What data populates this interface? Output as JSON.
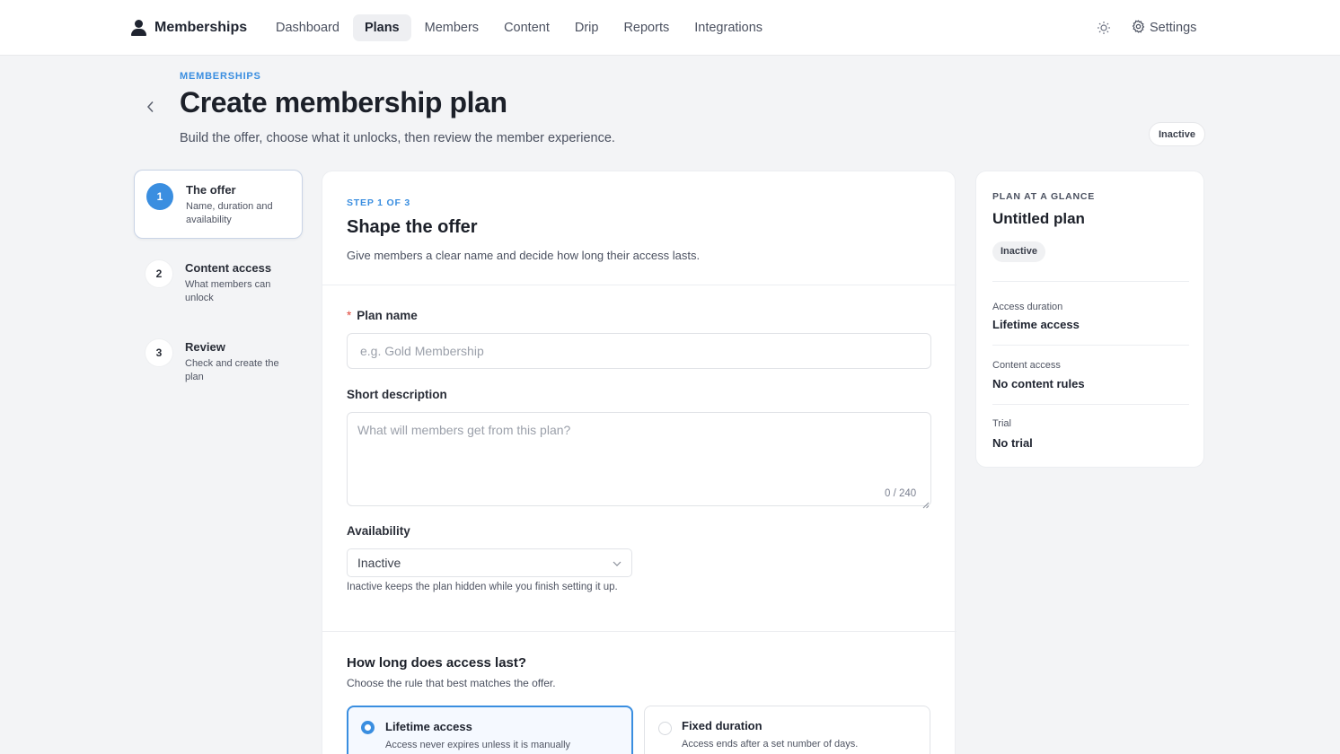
{
  "nav": {
    "brand": "Memberships",
    "links": [
      "Dashboard",
      "Plans",
      "Members",
      "Content",
      "Drip",
      "Reports",
      "Integrations"
    ],
    "active": "Plans",
    "settings_label": "Settings",
    "theme_icon": "sun-icon",
    "settings_icon": "gear-icon"
  },
  "header": {
    "eyebrow": "MEMBERSHIPS",
    "title": "Create membership plan",
    "subtitle": "Build the offer, choose what it unlocks, then review the member experience.",
    "status_badge": "Inactive"
  },
  "steps": [
    {
      "number": "1",
      "title": "The offer",
      "desc": "Name, duration and availability",
      "active": true
    },
    {
      "number": "2",
      "title": "Content access",
      "desc": "What members can unlock",
      "active": false
    },
    {
      "number": "3",
      "title": "Review",
      "desc": "Check and create the plan",
      "active": false
    }
  ],
  "form": {
    "step_label": "STEP 1 OF 3",
    "title": "Shape the offer",
    "subtitle": "Give members a clear name and decide how long their access lasts.",
    "plan_name": {
      "required_mark": "*",
      "label": "Plan name",
      "value": "",
      "placeholder": "e.g. Gold Membership"
    },
    "description": {
      "label": "Short description",
      "value": "",
      "placeholder": "What will members get from this plan?",
      "counter": "0 / 240"
    },
    "availability": {
      "label": "Availability",
      "value": "Inactive",
      "helper": "Inactive keeps the plan hidden while you finish setting it up."
    },
    "duration": {
      "title": "How long does access last?",
      "subtitle": "Choose the rule that best matches the offer.",
      "options": [
        {
          "title": "Lifetime access",
          "desc": "Access never expires unless it is manually",
          "selected": true
        },
        {
          "title": "Fixed duration",
          "desc": "Access ends after a set number of days.",
          "selected": false
        }
      ]
    }
  },
  "glance": {
    "eyebrow": "PLAN AT A GLANCE",
    "title": "Untitled plan",
    "status": "Inactive",
    "rows": [
      {
        "key": "Access duration",
        "value": "Lifetime access"
      },
      {
        "key": "Content access",
        "value": "No content rules"
      },
      {
        "key": "Trial",
        "value": "No trial"
      }
    ]
  },
  "colors": {
    "accent": "#3a8ee0",
    "required": "#e0483d",
    "page_bg": "#f3f4f6"
  }
}
